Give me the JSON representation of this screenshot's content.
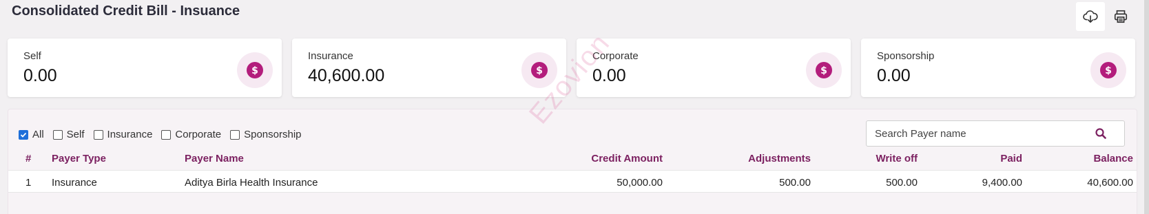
{
  "page": {
    "title": "Consolidated Credit Bill - Insuance"
  },
  "actions": {
    "download_icon": "download-cloud-icon",
    "print_icon": "printer-icon"
  },
  "summary_cards": [
    {
      "label": "Self",
      "value": "0.00",
      "icon": "dollar-coin-icon"
    },
    {
      "label": "Insurance",
      "value": "40,600.00",
      "icon": "dollar-coin-icon"
    },
    {
      "label": "Corporate",
      "value": "0.00",
      "icon": "dollar-coin-icon"
    },
    {
      "label": "Sponsorship",
      "value": "0.00",
      "icon": "dollar-coin-icon"
    }
  ],
  "filters": [
    {
      "label": "All",
      "checked": true
    },
    {
      "label": "Self",
      "checked": false
    },
    {
      "label": "Insurance",
      "checked": false
    },
    {
      "label": "Corporate",
      "checked": false
    },
    {
      "label": "Sponsorship",
      "checked": false
    }
  ],
  "search": {
    "placeholder": "Search Payer name",
    "value": ""
  },
  "table": {
    "columns": [
      "#",
      "Payer Type",
      "Payer Name",
      "Credit Amount",
      "Adjustments",
      "Write off",
      "Paid",
      "Balance"
    ],
    "rows": [
      [
        "1",
        "Insurance",
        "Aditya Birla Health Insurance",
        "50,000.00",
        "500.00",
        "500.00",
        "9,400.00",
        "40,600.00"
      ]
    ]
  },
  "watermark": "Ezovion",
  "colors": {
    "accent": "#b31d7c",
    "header_text": "#7c2161",
    "checkbox": "#1e6fd9"
  }
}
